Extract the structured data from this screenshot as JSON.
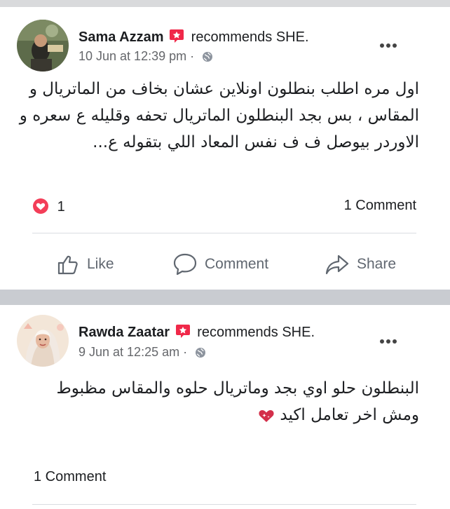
{
  "posts": [
    {
      "author": "Sama Azzam",
      "action": "recommends SHE.",
      "time": "10 Jun at 12:39 pm",
      "separator": "·",
      "text": "اول مره اطلب بنطلون اونلاين عشان بخاف من الماتريال و المقاس ، بس بجد البنطلون الماتريال تحفه وقليله ع سعره و الاوردر بيوصل ف ف نفس المعاد اللي بتقوله ع...",
      "reactions_count": "1",
      "comments_label": "1 Comment",
      "actions": {
        "like": "Like",
        "comment": "Comment",
        "share": "Share"
      }
    },
    {
      "author": "Rawda Zaatar",
      "action": "recommends SHE.",
      "time": "9 Jun at 12:25 am",
      "separator": "·",
      "text": "البنطلون حلو اوي بجد وماتريال حلوه والمقاس مظبوط ومش اخر تعامل اكيد",
      "comments_label": "1 Comment"
    }
  ],
  "icons": {
    "recommend": "recommend-badge-icon",
    "audience": "globe-icon",
    "more": "more-options-icon",
    "reaction": "love-reaction-icon",
    "like": "thumbs-up-icon",
    "comment": "speech-bubble-icon",
    "share": "share-arrow-icon",
    "emoji": "sparkling-heart-emoji"
  },
  "colors": {
    "recommend_red": "#f02849",
    "secondary_text": "#65676b",
    "divider": "#dadde1",
    "separator_band": "#c9ccd1"
  }
}
